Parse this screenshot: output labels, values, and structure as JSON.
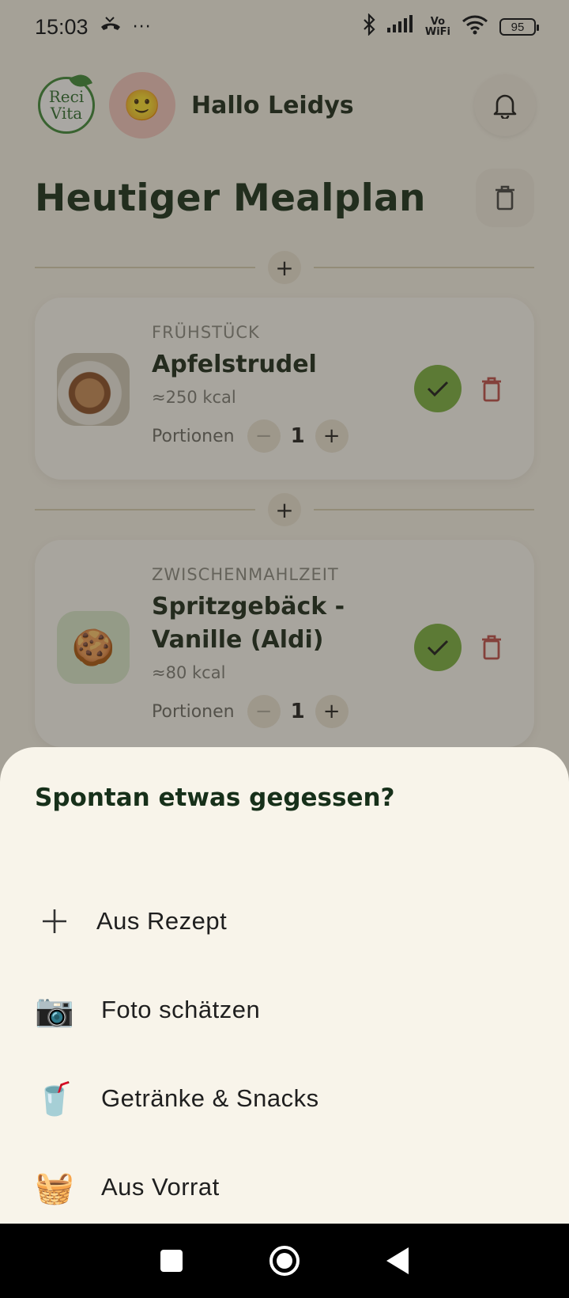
{
  "status_bar": {
    "time": "15:03",
    "dots": "···",
    "volte_top": "Vo",
    "volte_bottom": "WiFi",
    "battery": "95"
  },
  "header": {
    "logo_line1": "Reci",
    "logo_line2": "Vita",
    "avatar_emoji": "🙂",
    "greeting": "Hallo Leidys"
  },
  "page": {
    "title": "Heutiger Mealplan"
  },
  "meals": [
    {
      "type": "FRÜHSTÜCK",
      "name": "Apfelstrudel",
      "kcal": "≈250 kcal",
      "portions_label": "Portionen",
      "portions": "1"
    },
    {
      "type": "ZWISCHENMAHLZEIT",
      "name": "Spritzgebäck - Vanille (Aldi)",
      "kcal": "≈80 kcal",
      "portions_label": "Portionen",
      "portions": "1",
      "thumb_emoji": "🍪"
    }
  ],
  "sheet": {
    "title": "Spontan etwas gegessen?",
    "items": [
      {
        "icon": "plus-icon",
        "glyph": "+",
        "label": "Aus Rezept"
      },
      {
        "icon": "camera-icon",
        "glyph": "📷",
        "label": "Foto schätzen"
      },
      {
        "icon": "cup-icon",
        "glyph": "🥤",
        "label": "Getränke & Snacks"
      },
      {
        "icon": "basket-icon",
        "glyph": "🧺",
        "label": "Aus Vorrat"
      }
    ]
  },
  "colors": {
    "background": "#f8f4ea",
    "accent_green": "#7bb242",
    "title_green": "#17301a",
    "delete_red": "#c0504d"
  }
}
